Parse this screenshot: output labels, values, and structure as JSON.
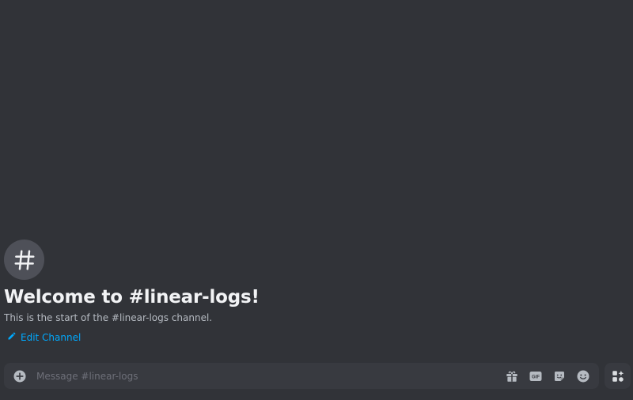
{
  "channel": {
    "name": "linear-logs"
  },
  "welcome": {
    "icon": "hash-icon",
    "title": "Welcome to #linear-logs!",
    "subtitle": "This is the start of the #linear-logs channel.",
    "edit_label": "Edit Channel",
    "edit_icon": "pencil-icon"
  },
  "composer": {
    "placeholder": "Message #linear-logs",
    "attach_icon": "plus-circle-icon",
    "icons": [
      "gift-icon",
      "gif-icon",
      "sticker-icon",
      "emoji-icon"
    ],
    "gif_text": "GIF",
    "apps_icon": "apps-icon"
  },
  "colors": {
    "background": "#313338",
    "composer": "#383a40",
    "link": "#00a8fc",
    "title": "#f2f3f5",
    "muted": "#b5bac1",
    "icon": "#b5bac1"
  }
}
